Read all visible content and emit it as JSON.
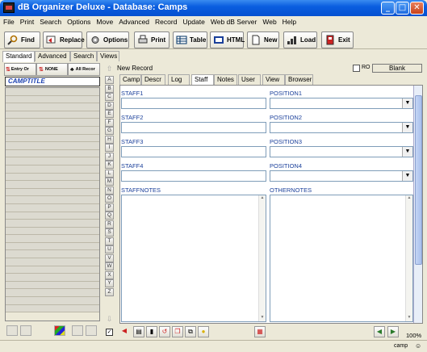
{
  "window": {
    "title": "dB Organizer Deluxe - Database: Camps"
  },
  "menu": [
    "File",
    "Print",
    "Search",
    "Options",
    "Move",
    "Advanced",
    "Record",
    "Update",
    "Web dB Server",
    "Web",
    "Help"
  ],
  "toolbar": {
    "find": "Find",
    "replace": "Replace",
    "options": "Options",
    "print": "Print",
    "table": "Table",
    "html": "HTML",
    "new": "New",
    "load": "Load",
    "exit": "Exit"
  },
  "viewtabs": [
    "Standard",
    "Advanced",
    "Search",
    "Views"
  ],
  "leftpane": {
    "entry_btn": "Entry Or",
    "none_btn": "NONE",
    "all_btn": "All Recor",
    "column_title": "CAMPTITLE"
  },
  "alphabet": [
    "A",
    "B",
    "C",
    "D",
    "E",
    "F",
    "G",
    "H",
    "I",
    "J",
    "K",
    "L",
    "M",
    "N",
    "O",
    "P",
    "Q",
    "R",
    "S",
    "T",
    "U",
    "V",
    "W",
    "X",
    "Y",
    "Z"
  ],
  "record": {
    "header": "New Record",
    "ro_label": "RO",
    "blank_btn": "Blank",
    "tabs": [
      "Camp",
      "Descr",
      "Log",
      "Staff",
      "Notes",
      "User",
      "View",
      "Browser"
    ],
    "active_tab": "Staff",
    "fields": {
      "staff1": "STAFF1",
      "position1": "POSITION1",
      "staff2": "STAFF2",
      "position2": "POSITION2",
      "staff3": "STAFF3",
      "position3": "POSITION3",
      "staff4": "STAFF4",
      "position4": "POSITION4",
      "staffnotes": "STAFFNOTES",
      "othernotes": "OTHERNOTES"
    }
  },
  "status": {
    "zoom": "100%",
    "user": "camp"
  },
  "colors": {
    "titlebar": "#0a5ee0",
    "label_blue": "#1a3f9a",
    "camptitle": "#1a3fb0"
  }
}
